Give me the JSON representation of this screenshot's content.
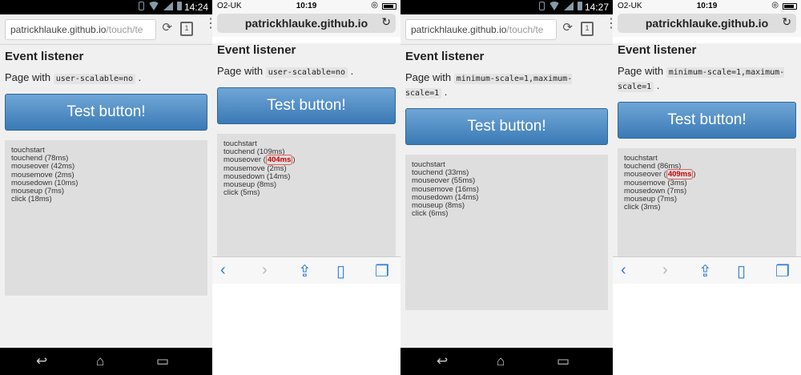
{
  "panels": [
    {
      "status_time": "14:24",
      "url_host": "patrickhlauke.github.io",
      "url_path": "/touch/te",
      "tab_count": "1",
      "heading": "Event listener",
      "desc_prefix": "Page with",
      "desc_code": "user-scalable=no",
      "desc_suffix": ".",
      "button_label": "Test button!",
      "log": [
        {
          "text": "touchstart",
          "time": ""
        },
        {
          "text": "touchend",
          "time": "(78ms)"
        },
        {
          "text": "mouseover",
          "time": "(42ms)"
        },
        {
          "text": "mousemove",
          "time": "(2ms)"
        },
        {
          "text": "mousedown",
          "time": "(10ms)"
        },
        {
          "text": "mouseup",
          "time": "(7ms)"
        },
        {
          "text": "click",
          "time": "(18ms)"
        }
      ]
    },
    {
      "carrier": "O2-UK",
      "status_time": "10:19",
      "url_host": "patrickhlauke.github.io",
      "heading": "Event listener",
      "desc_prefix": "Page with",
      "desc_code": "user-scalable=no",
      "desc_suffix": ".",
      "button_label": "Test button!",
      "log": [
        {
          "text": "touchstart",
          "time": ""
        },
        {
          "text": "touchend",
          "time": "(109ms)"
        },
        {
          "text": "mouseover",
          "time": "(404ms)",
          "highlight": true
        },
        {
          "text": "mousemove",
          "time": "(2ms)"
        },
        {
          "text": "mousedown",
          "time": "(14ms)"
        },
        {
          "text": "mouseup",
          "time": "(8ms)"
        },
        {
          "text": "click",
          "time": "(5ms)"
        }
      ]
    },
    {
      "status_time": "14:27",
      "url_host": "patrickhlauke.github.io",
      "url_path": "/touch/te",
      "tab_count": "1",
      "heading": "Event listener",
      "desc_prefix": "Page with",
      "desc_code": "minimum-scale=1,maximum-scale=1",
      "desc_suffix": ".",
      "button_label": "Test button!",
      "log": [
        {
          "text": "touchstart",
          "time": ""
        },
        {
          "text": "touchend",
          "time": "(33ms)"
        },
        {
          "text": "mouseover",
          "time": "(55ms)"
        },
        {
          "text": "mousemove",
          "time": "(16ms)"
        },
        {
          "text": "mousedown",
          "time": "(14ms)"
        },
        {
          "text": "mouseup",
          "time": "(8ms)"
        },
        {
          "text": "click",
          "time": "(6ms)"
        }
      ]
    },
    {
      "carrier": "O2-UK",
      "status_time": "10:19",
      "url_host": "patrickhlauke.github.io",
      "heading": "Event listener",
      "desc_prefix": "Page with",
      "desc_code": "minimum-scale=1,maximum-scale=1",
      "desc_suffix": ".",
      "button_label": "Test button!",
      "log": [
        {
          "text": "touchstart",
          "time": ""
        },
        {
          "text": "touchend",
          "time": "(86ms)"
        },
        {
          "text": "mouseover",
          "time": "(409ms)",
          "highlight": true
        },
        {
          "text": "mousemove",
          "time": "(3ms)"
        },
        {
          "text": "mousedown",
          "time": "(7ms)"
        },
        {
          "text": "mouseup",
          "time": "(7ms)"
        },
        {
          "text": "click",
          "time": "(3ms)"
        }
      ]
    }
  ],
  "colors": {
    "button": "#4a8ac4",
    "highlight": "#cc0000",
    "ios_tint": "#2f7dd8"
  },
  "icons": {
    "android_nav": [
      "back-arrow-icon",
      "home-icon",
      "recent-apps-icon"
    ],
    "ios_toolbar": [
      "back-icon",
      "forward-icon",
      "share-icon",
      "bookmarks-icon",
      "tabs-icon"
    ]
  }
}
